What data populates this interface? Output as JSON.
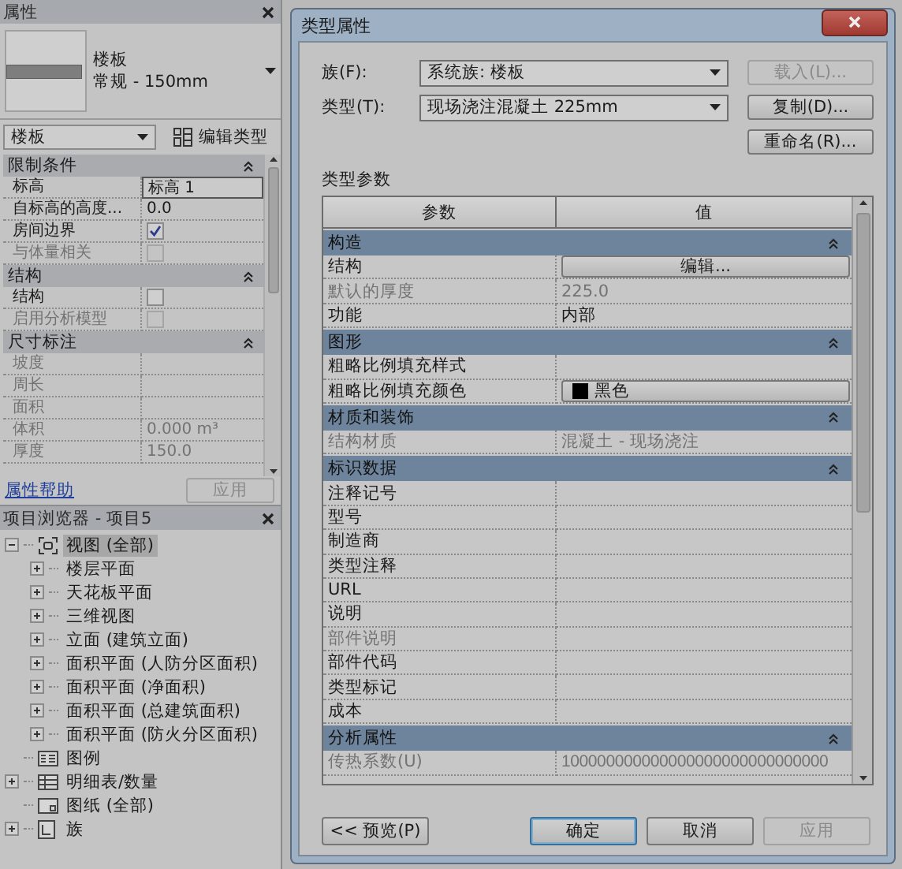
{
  "properties_panel": {
    "title": "属性",
    "type_selector": {
      "family": "楼板",
      "type": "常规 - 150mm"
    },
    "category_dropdown": "楼板",
    "edit_type_button": "编辑类型",
    "groups": [
      {
        "title": "限制条件",
        "expanded": true,
        "rows": [
          {
            "label": "标高",
            "kind": "field",
            "value": "标高 1",
            "disabled": false
          },
          {
            "label": "自标高的高度...",
            "kind": "text",
            "value": "0.0",
            "disabled": false
          },
          {
            "label": "房间边界",
            "kind": "checkbox",
            "checked": true,
            "disabled": false
          },
          {
            "label": "与体量相关",
            "kind": "checkbox",
            "checked": false,
            "disabled": true
          }
        ]
      },
      {
        "title": "结构",
        "expanded": true,
        "rows": [
          {
            "label": "结构",
            "kind": "checkbox",
            "checked": false,
            "disabled": false
          },
          {
            "label": "启用分析模型",
            "kind": "checkbox",
            "checked": false,
            "disabled": true
          }
        ]
      },
      {
        "title": "尺寸标注",
        "expanded": true,
        "rows": [
          {
            "label": "坡度",
            "kind": "text",
            "disabled": true
          },
          {
            "label": "周长",
            "kind": "text",
            "disabled": true
          },
          {
            "label": "面积",
            "kind": "text",
            "disabled": true
          },
          {
            "label": "体积",
            "kind": "text",
            "value": "0.000 m³",
            "disabled": true
          },
          {
            "label": "厚度",
            "kind": "text",
            "value": "150.0",
            "disabled": true
          }
        ]
      }
    ],
    "help_link": "属性帮助",
    "apply_button": {
      "label": "应用",
      "disabled": true
    }
  },
  "project_browser": {
    "title": "项目浏览器 - 项目5",
    "tree": [
      {
        "label": "视图 (全部)",
        "kind": "views",
        "expanded": true,
        "selected": true,
        "children": [
          {
            "label": "楼层平面",
            "expanded": false,
            "selected": false
          },
          {
            "label": "天花板平面",
            "expanded": false,
            "selected": false
          },
          {
            "label": "三维视图",
            "expanded": false,
            "selected": false
          },
          {
            "label": "立面 (建筑立面)",
            "expanded": false,
            "selected": false
          },
          {
            "label": "面积平面 (人防分区面积)",
            "expanded": false,
            "selected": false
          },
          {
            "label": "面积平面 (净面积)",
            "expanded": false,
            "selected": false
          },
          {
            "label": "面积平面 (总建筑面积)",
            "expanded": false,
            "selected": false
          },
          {
            "label": "面积平面 (防火分区面积)",
            "expanded": false,
            "selected": false
          }
        ]
      },
      {
        "label": "图例",
        "kind": "legend",
        "selected": false
      },
      {
        "label": "明细表/数量",
        "kind": "schedule",
        "expanded": false,
        "selected": false
      },
      {
        "label": "图纸 (全部)",
        "kind": "sheets",
        "selected": false
      },
      {
        "label": "族",
        "kind": "families",
        "expanded": false,
        "selected": false
      }
    ]
  },
  "dialog": {
    "title": "类型属性",
    "family_label": "族(F):",
    "family_dropdown": "系统族: 楼板",
    "load_button": {
      "label": "载入(L)...",
      "disabled": true
    },
    "type_label": "类型(T):",
    "type_dropdown": "现场浇注混凝土 225mm",
    "duplicate_button": {
      "label": "复制(D)...",
      "disabled": false
    },
    "rename_button": {
      "label": "重命名(R)...",
      "disabled": false
    },
    "parameters": {
      "title": "类型参数",
      "columns": [
        "参数",
        "值"
      ],
      "groups": [
        {
          "title": "构造",
          "expanded": true,
          "rows": [
            {
              "label": "结构",
              "kind": "button",
              "value": "编辑...",
              "disabled": false
            },
            {
              "label": "默认的厚度",
              "kind": "text",
              "value": "225.0",
              "disabled": true
            },
            {
              "label": "功能",
              "kind": "text",
              "value": "内部",
              "disabled": false
            }
          ]
        },
        {
          "title": "图形",
          "expanded": true,
          "rows": [
            {
              "label": "粗略比例填充样式",
              "kind": "text",
              "disabled": false
            },
            {
              "label": "粗略比例填充颜色",
              "kind": "color",
              "value": "黑色",
              "color": "#000000",
              "disabled": false
            }
          ]
        },
        {
          "title": "材质和装饰",
          "expanded": true,
          "rows": [
            {
              "label": "结构材质",
              "kind": "text",
              "value": "混凝土 - 现场浇注",
              "disabled": true
            }
          ]
        },
        {
          "title": "标识数据",
          "expanded": true,
          "rows": [
            {
              "label": "注释记号",
              "kind": "text",
              "disabled": false
            },
            {
              "label": "型号",
              "kind": "text",
              "disabled": false
            },
            {
              "label": "制造商",
              "kind": "text",
              "disabled": false
            },
            {
              "label": "类型注释",
              "kind": "text",
              "disabled": false
            },
            {
              "label": "URL",
              "kind": "text",
              "disabled": false
            },
            {
              "label": "说明",
              "kind": "text",
              "disabled": false
            },
            {
              "label": "部件说明",
              "kind": "text",
              "disabled": true
            },
            {
              "label": "部件代码",
              "kind": "text",
              "disabled": false
            },
            {
              "label": "类型标记",
              "kind": "text",
              "disabled": false
            },
            {
              "label": "成本",
              "kind": "text",
              "disabled": false
            }
          ]
        },
        {
          "title": "分析属性",
          "expanded": true,
          "rows": [
            {
              "label": "传热系数(U)",
              "kind": "text",
              "value": "100000000000000000000000000000",
              "disabled": true
            }
          ]
        }
      ]
    },
    "footer_buttons": [
      {
        "label": "<< 预览(P)",
        "kind": "preview",
        "default": false,
        "disabled": false
      },
      {
        "label": "确定",
        "kind": "action",
        "default": true,
        "disabled": false
      },
      {
        "label": "取消",
        "kind": "action",
        "default": false,
        "disabled": false
      },
      {
        "label": "应用",
        "kind": "action",
        "default": false,
        "disabled": true
      }
    ]
  }
}
